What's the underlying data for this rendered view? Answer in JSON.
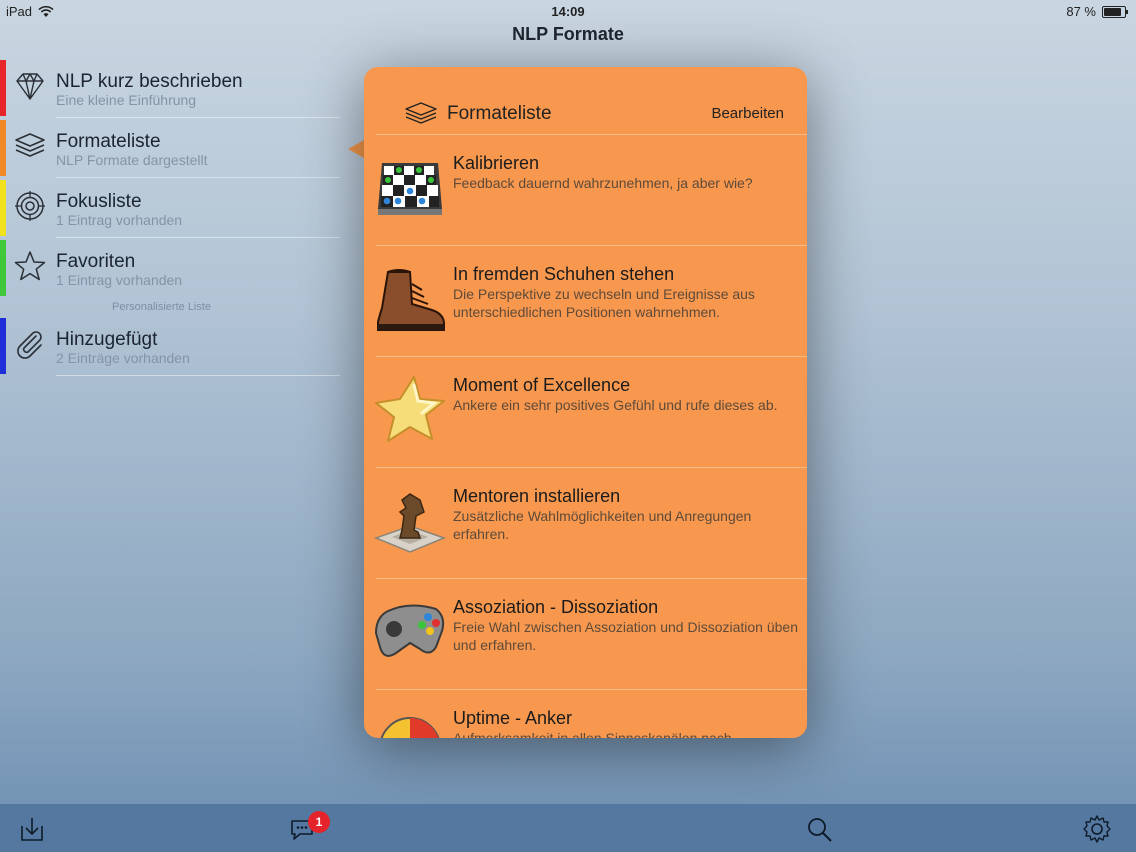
{
  "status_bar": {
    "device": "iPad",
    "time": "14:09",
    "battery": "87 %"
  },
  "nav": {
    "title": "NLP Formate"
  },
  "sidebar": {
    "items": [
      {
        "title": "NLP kurz beschrieben",
        "subtitle": "Eine kleine Einführung",
        "color": "#e8262a",
        "icon": "diamond-icon"
      },
      {
        "title": "Formateliste",
        "subtitle": "NLP Formate dargestellt",
        "color": "#f08a28",
        "icon": "layers-icon"
      },
      {
        "title": "Fokusliste",
        "subtitle": "1 Eintrag vorhanden",
        "color": "#f2e21d",
        "icon": "target-icon"
      },
      {
        "title": "Favoriten",
        "subtitle": "1 Eintrag vorhanden",
        "color": "#3ec83a",
        "icon": "star-icon"
      }
    ],
    "section_label": "Personalisierte Liste",
    "extra_items": [
      {
        "title": "Hinzugefügt",
        "subtitle": "2 Einträge vorhanden",
        "color": "#1f2ed8",
        "icon": "paperclip-icon"
      }
    ]
  },
  "popover": {
    "title": "Formateliste",
    "edit_label": "Bearbeiten",
    "background": "#f7984e",
    "rows": [
      {
        "title": "Kalibrieren",
        "desc": "Feedback dauernd wahrzunehmen, ja aber wie?",
        "icon": "checkerboard-icon"
      },
      {
        "title": "In fremden Schuhen stehen",
        "desc": "Die Perspektive zu wechseln und Ereignisse aus unterschiedlichen Positionen wahrnehmen.",
        "icon": "boot-icon"
      },
      {
        "title": "Moment of Excellence",
        "desc": "Ankere ein sehr positives Gefühl und rufe dieses ab.",
        "icon": "star-icon"
      },
      {
        "title": "Mentoren installieren",
        "desc": "Zusätzliche Wahlmöglichkeiten und Anregungen erfahren.",
        "icon": "chess-knight-icon"
      },
      {
        "title": "Assoziation - Dissoziation",
        "desc": "Freie Wahl zwischen Assoziation und Dissoziation üben und erfahren.",
        "icon": "gamepad-icon"
      },
      {
        "title": "Uptime - Anker",
        "desc": "Aufmerksamkeit in allen Sinneskanälen nach",
        "icon": "pie-chart-icon"
      }
    ]
  },
  "toolbar": {
    "badge_count": "1"
  }
}
